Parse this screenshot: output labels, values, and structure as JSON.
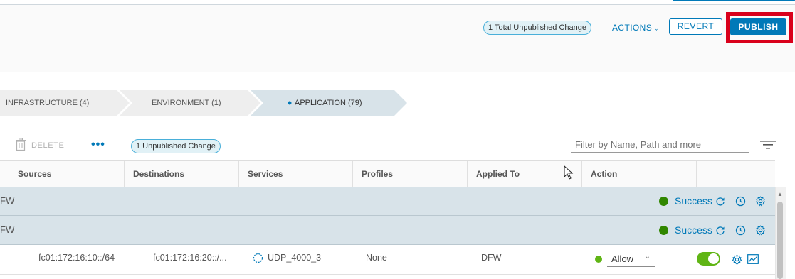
{
  "header": {
    "total_changes_badge": "1 Total Unpublished Change",
    "actions_label": "ACTIONS",
    "revert_label": "REVERT",
    "publish_label": "PUBLISH"
  },
  "breadcrumb": {
    "items": [
      {
        "label": "INFRASTRUCTURE (4)",
        "active": false
      },
      {
        "label": "ENVIRONMENT (1)",
        "active": false
      },
      {
        "label": "APPLICATION (79)",
        "active": true
      }
    ]
  },
  "toolbar": {
    "delete_label": "DELETE",
    "more_label": "•••",
    "unpublished_badge": "1 Unpublished Change",
    "filter_placeholder": "Filter by Name, Path and more"
  },
  "table": {
    "columns": [
      "Sources",
      "Destinations",
      "Services",
      "Profiles",
      "Applied To",
      "Action"
    ],
    "group_rows": [
      {
        "name": "FW",
        "status": "Success"
      },
      {
        "name": "FW",
        "status": "Success"
      }
    ],
    "rule": {
      "source": "fc01:172:16:10::/64",
      "destination": "fc01:172:16:20::/...",
      "service": "UDP_4000_3",
      "profile": "None",
      "applied_to": "DFW",
      "action": "Allow",
      "enabled": true
    }
  },
  "colors": {
    "accent": "#0079b8",
    "success": "#318700",
    "allow": "#60b515",
    "highlight": "#d9001b",
    "group_row_bg": "#d8e3e9"
  },
  "icons": [
    "trash-icon",
    "filter-icon",
    "refresh-icon",
    "history-icon",
    "gear-icon",
    "service-icon",
    "chart-icon",
    "chevron-down-icon"
  ]
}
